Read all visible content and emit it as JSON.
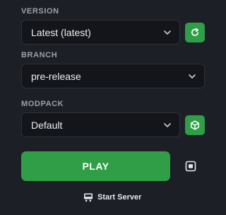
{
  "version": {
    "label": "VERSION",
    "selected": "Latest (latest)",
    "refresh_icon": "refresh-icon"
  },
  "branch": {
    "label": "BRANCH",
    "selected": "pre-release"
  },
  "modpack": {
    "label": "MODPACK",
    "selected": "Default",
    "cube_icon": "cube-icon"
  },
  "actions": {
    "play_label": "PLAY",
    "screen_icon": "screen-icon",
    "start_server_label": "Start Server",
    "server_icon": "server-icon"
  },
  "colors": {
    "background": "#1c1f26",
    "field": "#13151b",
    "accent_green": "#2f9e47",
    "label": "#9aa0ab"
  }
}
